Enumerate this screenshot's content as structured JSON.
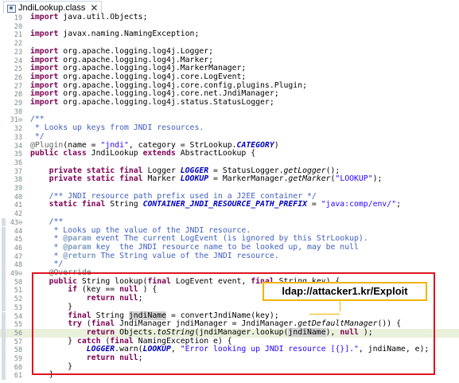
{
  "tab": {
    "title": "JndiLookup.class",
    "close_glyph": "✕",
    "icon": "class-file-icon"
  },
  "lines": [
    {
      "n": "19",
      "t": [
        [
          "kw",
          "import"
        ],
        [
          "",
          "java.util.Objects;"
        ]
      ]
    },
    {
      "n": "20",
      "t": []
    },
    {
      "n": "21",
      "t": [
        [
          "kw",
          "import"
        ],
        [
          "",
          "javax.naming.NamingException;"
        ]
      ]
    },
    {
      "n": "22",
      "t": []
    },
    {
      "n": "23",
      "t": [
        [
          "kw",
          "import"
        ],
        [
          "",
          "org.apache.logging.log4j.Logger;"
        ]
      ]
    },
    {
      "n": "24",
      "t": [
        [
          "kw",
          "import"
        ],
        [
          "",
          "org.apache.logging.log4j.Marker;"
        ]
      ]
    },
    {
      "n": "25",
      "t": [
        [
          "kw",
          "import"
        ],
        [
          "",
          "org.apache.logging.log4j.MarkerManager;"
        ]
      ]
    },
    {
      "n": "26",
      "t": [
        [
          "kw",
          "import"
        ],
        [
          "",
          "org.apache.logging.log4j.core.LogEvent;"
        ]
      ]
    },
    {
      "n": "27",
      "t": [
        [
          "kw",
          "import"
        ],
        [
          "",
          "org.apache.logging.log4j.core.config.plugins.Plugin;"
        ]
      ]
    },
    {
      "n": "28",
      "t": [
        [
          "kw",
          "import"
        ],
        [
          "",
          "org.apache.logging.log4j.core.net.JndiManager;"
        ]
      ]
    },
    {
      "n": "29",
      "t": [
        [
          "kw",
          "import"
        ],
        [
          "",
          "org.apache.logging.log4j.status.StatusLogger;"
        ]
      ]
    },
    {
      "n": "30",
      "t": []
    },
    {
      "n": "31⊖",
      "t": [
        [
          "cmt",
          "/**"
        ]
      ]
    },
    {
      "n": "32",
      "t": [
        [
          "cmt",
          " * Looks up keys from JNDI resources."
        ]
      ]
    },
    {
      "n": "33",
      "t": [
        [
          "cmt",
          " */"
        ]
      ]
    },
    {
      "n": "34",
      "t": [
        [
          "ann",
          "@Plugin"
        ],
        [
          "",
          "(name = "
        ],
        [
          "str",
          "\"jndi\""
        ],
        [
          "",
          ", category = StrLookup."
        ],
        [
          "fld",
          "CATEGORY"
        ],
        [
          "",
          ")"
        ]
      ]
    },
    {
      "n": "35",
      "t": [
        [
          "kw",
          "public class"
        ],
        [
          "",
          " JndiLookup "
        ],
        [
          "kw",
          "extends"
        ],
        [
          "",
          " AbstractLookup {"
        ]
      ]
    },
    {
      "n": "36",
      "t": []
    },
    {
      "n": "37",
      "t": [
        [
          "",
          "    "
        ],
        [
          "kw",
          "private static final"
        ],
        [
          "",
          " Logger "
        ],
        [
          "fld",
          "LOGGER"
        ],
        [
          "",
          " = StatusLogger."
        ],
        [
          "st",
          "getLogger"
        ],
        [
          "",
          "();"
        ]
      ]
    },
    {
      "n": "38",
      "t": [
        [
          "",
          "    "
        ],
        [
          "kw",
          "private static final"
        ],
        [
          "",
          " Marker "
        ],
        [
          "fld",
          "LOOKUP"
        ],
        [
          "",
          " = MarkerManager."
        ],
        [
          "st",
          "getMarker"
        ],
        [
          "",
          "("
        ],
        [
          "str",
          "\"LOOKUP\""
        ],
        [
          "",
          ");"
        ]
      ]
    },
    {
      "n": "39",
      "t": []
    },
    {
      "n": "40",
      "t": [
        [
          "",
          "    "
        ],
        [
          "cmt",
          "/** JNDI resource path prefix used in a J2EE container */"
        ]
      ]
    },
    {
      "n": "41",
      "t": [
        [
          "",
          "    "
        ],
        [
          "kw",
          "static final"
        ],
        [
          "",
          " String "
        ],
        [
          "fld",
          "CONTAINER_JNDI_RESOURCE_PATH_PREFIX"
        ],
        [
          "",
          " = "
        ],
        [
          "str",
          "\"java:comp/env/\""
        ],
        [
          "",
          ";"
        ]
      ]
    },
    {
      "n": "42",
      "t": []
    },
    {
      "n": "43⊖",
      "t": [
        [
          "",
          "    "
        ],
        [
          "cmt",
          "/**"
        ]
      ]
    },
    {
      "n": "44",
      "t": [
        [
          "cmt",
          "     * Looks up the value of the JNDI resource."
        ]
      ]
    },
    {
      "n": "45",
      "t": [
        [
          "cmt",
          "     * "
        ],
        [
          "tag",
          "@param"
        ],
        [
          "cmt",
          " event The current LogEvent (is ignored by this StrLookup)."
        ]
      ]
    },
    {
      "n": "46",
      "t": [
        [
          "cmt",
          "     * "
        ],
        [
          "tag",
          "@param"
        ],
        [
          "cmt",
          " key  the JNDI resource name to be looked up, may be null"
        ]
      ]
    },
    {
      "n": "47",
      "t": [
        [
          "cmt",
          "     * "
        ],
        [
          "tag",
          "@return"
        ],
        [
          "cmt",
          " The String value of the JNDI resource."
        ]
      ]
    },
    {
      "n": "48",
      "t": [
        [
          "cmt",
          "     */"
        ]
      ]
    },
    {
      "n": "49⊖",
      "t": [
        [
          "",
          "    "
        ],
        [
          "ann",
          "@Override"
        ]
      ]
    },
    {
      "n": "50",
      "t": [
        [
          "",
          "    "
        ],
        [
          "kw",
          "public"
        ],
        [
          "",
          " String lookup("
        ],
        [
          "kw",
          "final"
        ],
        [
          "",
          " LogEvent event, "
        ],
        [
          "kw",
          "final"
        ],
        [
          "",
          " String key) {"
        ]
      ]
    },
    {
      "n": "51",
      "t": [
        [
          "",
          "        "
        ],
        [
          "kw",
          "if"
        ],
        [
          "",
          " (key == "
        ],
        [
          "kw",
          "null"
        ],
        [
          "",
          ") {"
        ]
      ]
    },
    {
      "n": "52",
      "t": [
        [
          "",
          "            "
        ],
        [
          "kw",
          "return null"
        ],
        [
          "",
          ";"
        ]
      ]
    },
    {
      "n": "53",
      "t": [
        [
          "",
          "        }"
        ]
      ]
    },
    {
      "n": "54",
      "t": [
        [
          "",
          "        "
        ],
        [
          "kw",
          "final"
        ],
        [
          "",
          " String "
        ],
        [
          "occ",
          "jndiName"
        ],
        [
          "",
          " = convertJndiName(key);"
        ]
      ]
    },
    {
      "n": "55",
      "t": [
        [
          "",
          "        "
        ],
        [
          "kw",
          "try"
        ],
        [
          "",
          " ("
        ],
        [
          "kw",
          "final"
        ],
        [
          "",
          " JndiManager jndiManager = JndiManager."
        ],
        [
          "st",
          "getDefaultManager"
        ],
        [
          "",
          "()) {"
        ]
      ]
    },
    {
      "n": "56",
      "t": [
        [
          "",
          "            "
        ],
        [
          "kw",
          "return"
        ],
        [
          "",
          " Objects."
        ],
        [
          "st",
          "toString"
        ],
        [
          "",
          "(jndiManager.lookup("
        ],
        [
          "occ",
          "jndiName"
        ],
        [
          "",
          "), "
        ],
        [
          "kw",
          "null"
        ],
        [
          "",
          ");"
        ]
      ]
    },
    {
      "n": "57",
      "t": [
        [
          "",
          "        } "
        ],
        [
          "kw",
          "catch"
        ],
        [
          "",
          " ("
        ],
        [
          "kw",
          "final"
        ],
        [
          "",
          " NamingException e) {"
        ]
      ]
    },
    {
      "n": "58",
      "t": [
        [
          "",
          "            "
        ],
        [
          "fld",
          "LOGGER"
        ],
        [
          "",
          ".warn("
        ],
        [
          "fld",
          "LOOKUP"
        ],
        [
          "",
          ", "
        ],
        [
          "str",
          "\"Error looking up JNDI resource [{}].\""
        ],
        [
          "",
          ", jndiName, e);"
        ]
      ]
    },
    {
      "n": "59",
      "t": [
        [
          "",
          "            "
        ],
        [
          "kw",
          "return null"
        ],
        [
          "",
          ";"
        ]
      ]
    },
    {
      "n": "60",
      "t": [
        [
          "",
          "        }"
        ]
      ]
    },
    {
      "n": "61",
      "t": [
        [
          "",
          "    }"
        ]
      ]
    }
  ],
  "callout": {
    "text": "ldap://attacker1.kr/Exploit",
    "border_color": "#f0b400"
  },
  "highlight": {
    "box_color": "#e0141e",
    "current_line": "56"
  }
}
